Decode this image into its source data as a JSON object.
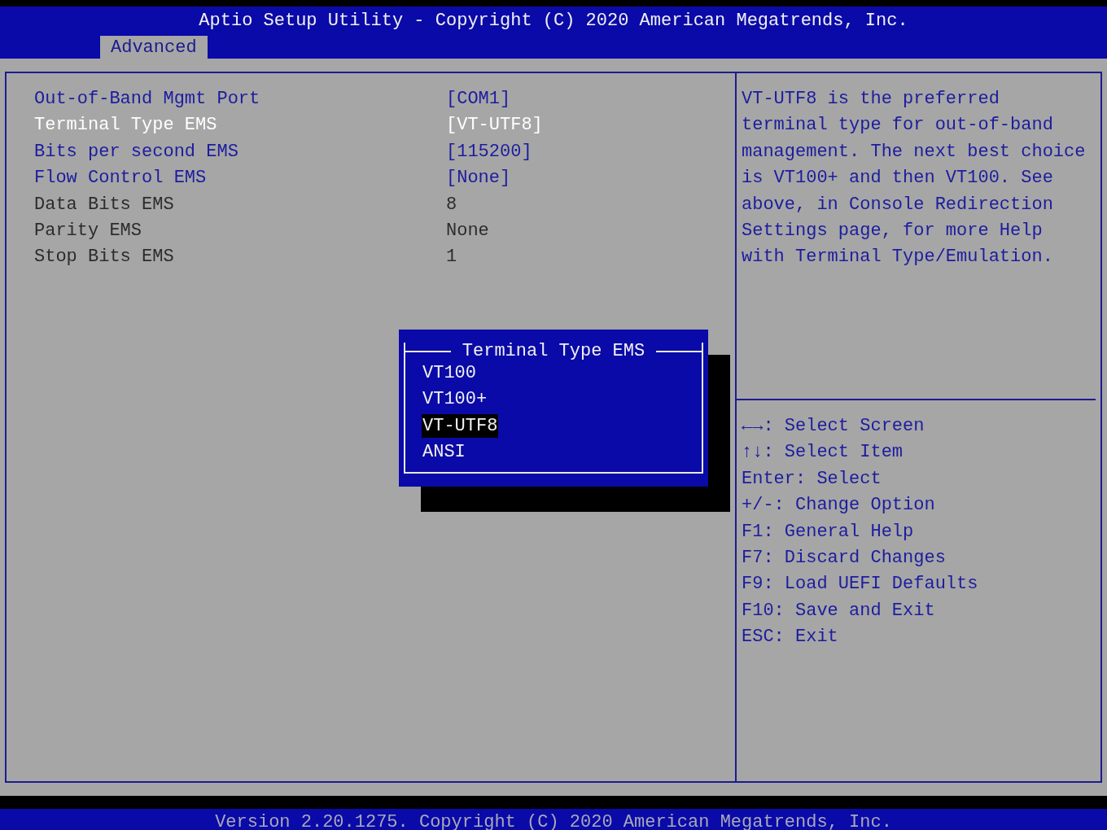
{
  "header": {
    "title": "Aptio Setup Utility - Copyright (C) 2020 American Megatrends, Inc.",
    "tabs": [
      {
        "label": "Advanced",
        "selected": true
      }
    ]
  },
  "settings": [
    {
      "label": "Out-of-Band Mgmt Port",
      "value": "[COM1]",
      "kind": "option",
      "selected": false
    },
    {
      "label": "Terminal Type EMS",
      "value": "[VT-UTF8]",
      "kind": "option",
      "selected": true
    },
    {
      "label": "Bits per second EMS",
      "value": "[115200]",
      "kind": "option",
      "selected": false
    },
    {
      "label": "Flow Control EMS",
      "value": "[None]",
      "kind": "option",
      "selected": false
    },
    {
      "label": "Data Bits EMS",
      "value": "8",
      "kind": "info",
      "selected": false
    },
    {
      "label": "Parity EMS",
      "value": "None",
      "kind": "info",
      "selected": false
    },
    {
      "label": "Stop Bits EMS",
      "value": "1",
      "kind": "info",
      "selected": false
    }
  ],
  "help": {
    "description": "VT-UTF8 is the preferred terminal type for out-of-band management. The next best choice is VT100+ and then VT100. See above, in Console Redirection Settings page, for more Help with Terminal Type/Emulation.",
    "keys": [
      "←→: Select Screen",
      "↑↓: Select Item",
      "Enter: Select",
      "+/-: Change Option",
      "F1: General Help",
      "F7: Discard Changes",
      "F9: Load UEFI Defaults",
      "F10: Save and Exit",
      "ESC: Exit"
    ]
  },
  "popup": {
    "title": "Terminal Type EMS",
    "options": [
      {
        "label": "VT100",
        "selected": false
      },
      {
        "label": "VT100+",
        "selected": false
      },
      {
        "label": "VT-UTF8",
        "selected": true
      },
      {
        "label": "ANSI",
        "selected": false
      }
    ]
  },
  "footer": {
    "text": "Version 2.20.1275. Copyright (C) 2020 American Megatrends, Inc."
  }
}
